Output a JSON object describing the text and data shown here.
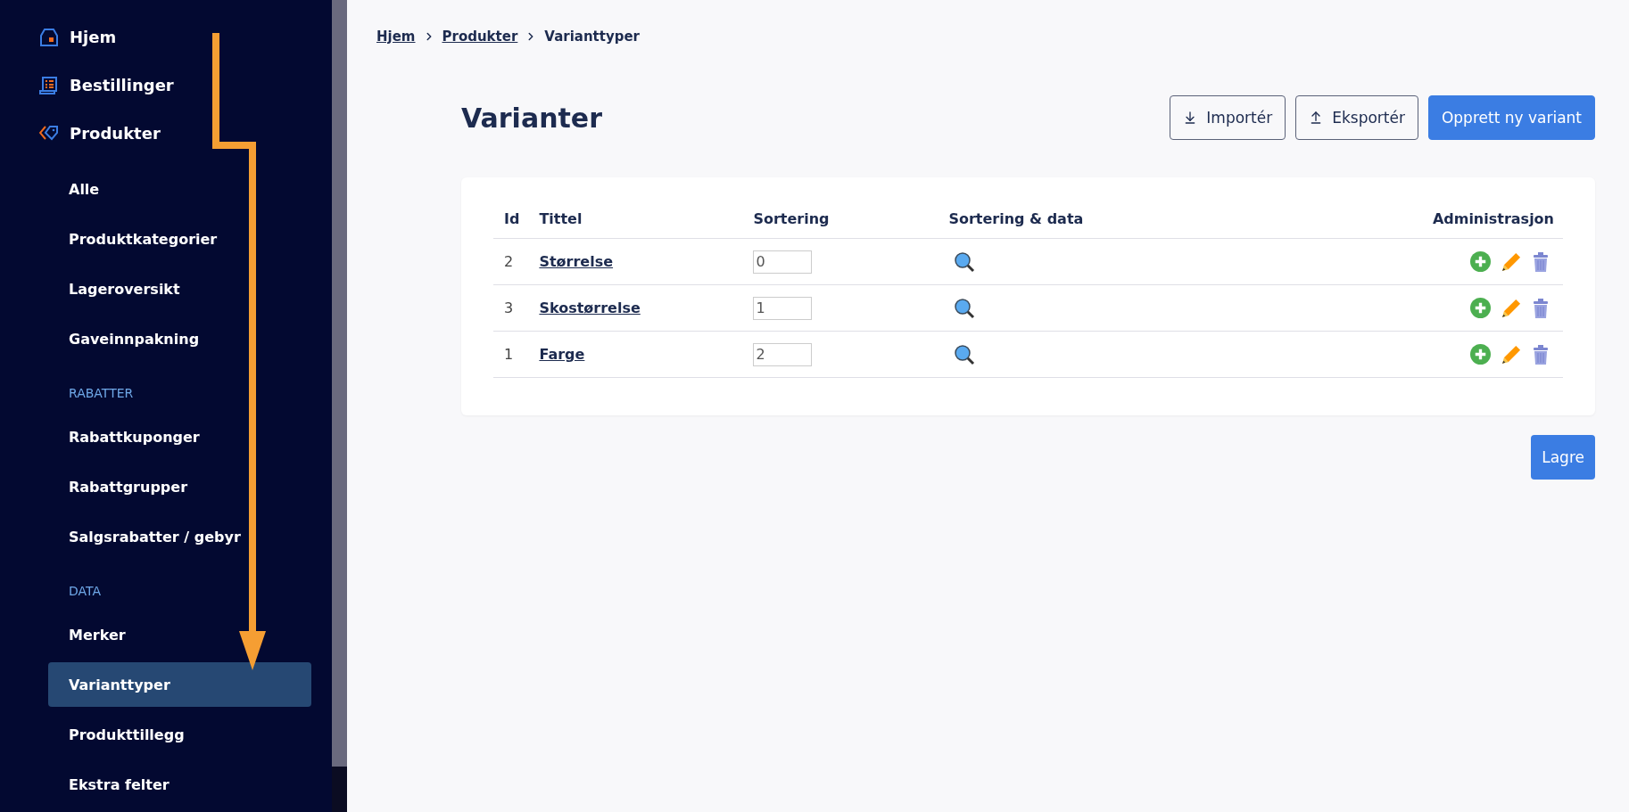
{
  "sidebar": {
    "main_items": [
      {
        "label": "Hjem"
      },
      {
        "label": "Bestillinger"
      },
      {
        "label": "Produkter"
      }
    ],
    "sub_items": [
      {
        "kind": "item",
        "label": "Alle",
        "selected": false
      },
      {
        "kind": "item",
        "label": "Produktkategorier",
        "selected": false
      },
      {
        "kind": "item",
        "label": "Lageroversikt",
        "selected": false
      },
      {
        "kind": "item",
        "label": "Gaveinnpakning",
        "selected": false
      },
      {
        "kind": "heading",
        "label": "RABATTER"
      },
      {
        "kind": "item",
        "label": "Rabattkuponger",
        "selected": false
      },
      {
        "kind": "item",
        "label": "Rabattgrupper",
        "selected": false
      },
      {
        "kind": "item",
        "label": "Salgsrabatter / gebyr",
        "selected": false
      },
      {
        "kind": "heading",
        "label": "DATA"
      },
      {
        "kind": "item",
        "label": "Merker",
        "selected": false
      },
      {
        "kind": "item",
        "label": "Varianttyper",
        "selected": true
      },
      {
        "kind": "item",
        "label": "Produkttillegg",
        "selected": false
      },
      {
        "kind": "item",
        "label": "Ekstra felter",
        "selected": false
      }
    ]
  },
  "breadcrumb": [
    {
      "label": "Hjem",
      "link": true
    },
    {
      "label": "Produkter",
      "link": true
    },
    {
      "label": "Varianttyper",
      "link": false
    }
  ],
  "page": {
    "title": "Varianter",
    "buttons": [
      {
        "kind": "import",
        "label": "Importér"
      },
      {
        "kind": "export",
        "label": "Eksportér"
      },
      {
        "kind": "primary",
        "label": "Opprett ny variant"
      }
    ]
  },
  "table": {
    "columns": [
      "Id",
      "Tittel",
      "Sortering",
      "Sortering & data",
      "Administrasjon"
    ],
    "rows": [
      {
        "id": "2",
        "title": "Størrelse",
        "sort": "0"
      },
      {
        "id": "3",
        "title": "Skostørrelse",
        "sort": "1"
      },
      {
        "id": "1",
        "title": "Farge",
        "sort": "2"
      }
    ]
  },
  "save_button": "Lagre"
}
